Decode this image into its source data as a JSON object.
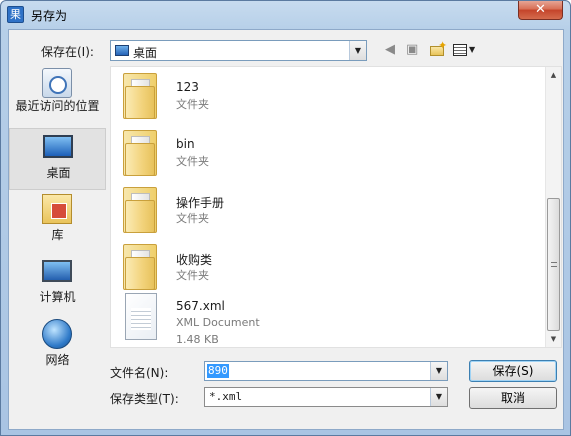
{
  "window": {
    "title": "另存为",
    "app_icon_glyph": "果",
    "close_glyph": "✕"
  },
  "toolbar": {
    "save_in_label": "保存在(I):",
    "save_in_value": "桌面",
    "back_icon": "arrow-left-icon",
    "up_icon": "folder-up-icon",
    "new_folder_icon": "new-folder-icon",
    "views_icon": "views-menu-icon"
  },
  "places": [
    {
      "label": "最近访问的位置",
      "icon": "recent-places-icon"
    },
    {
      "label": "桌面",
      "icon": "desktop-icon",
      "selected": true
    },
    {
      "label": "库",
      "icon": "libraries-icon"
    },
    {
      "label": "计算机",
      "icon": "computer-icon"
    },
    {
      "label": "网络",
      "icon": "network-icon"
    }
  ],
  "files": [
    {
      "name": "123",
      "type": "文件夹"
    },
    {
      "name": "bin",
      "type": "文件夹"
    },
    {
      "name": "操作手册",
      "type": "文件夹"
    },
    {
      "name": "收购类",
      "type": "文件夹"
    },
    {
      "name": "567.xml",
      "type": "XML Document",
      "size": "1.48 KB"
    }
  ],
  "form": {
    "filename_label": "文件名(N):",
    "filename_value": "890",
    "filetype_label": "保存类型(T):",
    "filetype_value": "*.xml",
    "save_button": "保存(S)",
    "cancel_button": "取消"
  },
  "colors": {
    "selection": "#3399ff",
    "frame": "#a9c4e3",
    "close": "#c4442a"
  }
}
